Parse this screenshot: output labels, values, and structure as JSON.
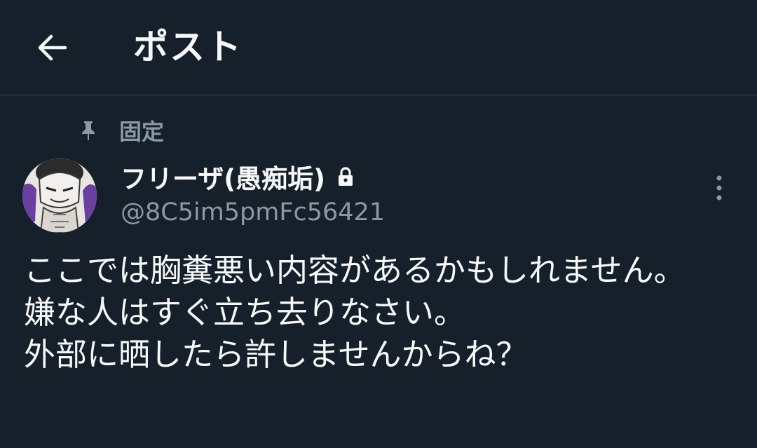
{
  "header": {
    "back_icon": "arrow-left-icon",
    "title": "ポスト"
  },
  "pinned": {
    "icon": "pin-icon",
    "label": "固定"
  },
  "author": {
    "avatar_icon": "avatar-image",
    "display_name": "フリーザ(愚痴垢)",
    "lock_icon": "lock-icon",
    "handle": "@8C5im5pmFc56421"
  },
  "more": {
    "icon": "more-vertical-icon"
  },
  "post": {
    "text": "ここでは胸糞悪い内容があるかもしれません。\n嫌な人はすぐ立ち去りなさい。\n外部に晒したら許しませんからね？"
  },
  "colors": {
    "background": "#15202b",
    "text_primary": "#f7f9f9",
    "text_secondary": "#8b98a5",
    "divider": "#38444d"
  }
}
